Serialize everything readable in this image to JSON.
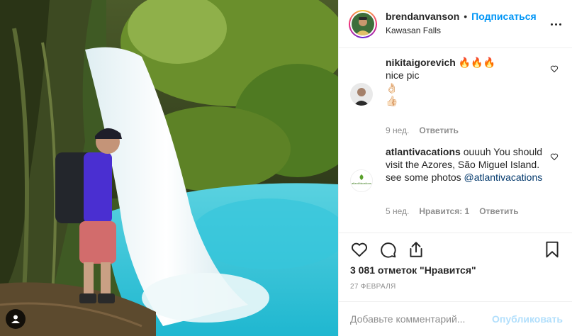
{
  "header": {
    "username": "brendanvanson",
    "separator": "•",
    "follow_label": "Подписаться",
    "location": "Kawasan Falls",
    "more_icon": "more-horizontal-icon"
  },
  "comments": [
    {
      "username": "nikitaigorevich",
      "emoji_after_name": "🔥🔥🔥",
      "text": "nice pic",
      "emoji_lines": [
        "👌🏻",
        "👍🏻"
      ],
      "time": "9 нед.",
      "likes_label": "",
      "reply_label": "Ответить"
    },
    {
      "username": "atlantivacations",
      "text": "ouuuh You should visit the Azores, São Miguel Island. see some photos",
      "mention": "@atlantivacations",
      "avatar_text": "atlantiVacations",
      "time": "5 нед.",
      "likes_label": "Нравится: 1",
      "reply_label": "Ответить"
    }
  ],
  "actions": {
    "like_icon": "heart-icon",
    "comment_icon": "comment-icon",
    "share_icon": "share-icon",
    "save_icon": "bookmark-icon"
  },
  "likes_text": "3 081 отметок \"Нравится\"",
  "date": "27 ФЕВРАЛЯ",
  "add_comment": {
    "placeholder": "Добавьте комментарий...",
    "publish_label": "Опубликовать"
  },
  "colors": {
    "accent": "#0095f6",
    "publish_disabled": "#b2dffc",
    "muted": "#8e8e8e",
    "mention": "#00376b"
  }
}
